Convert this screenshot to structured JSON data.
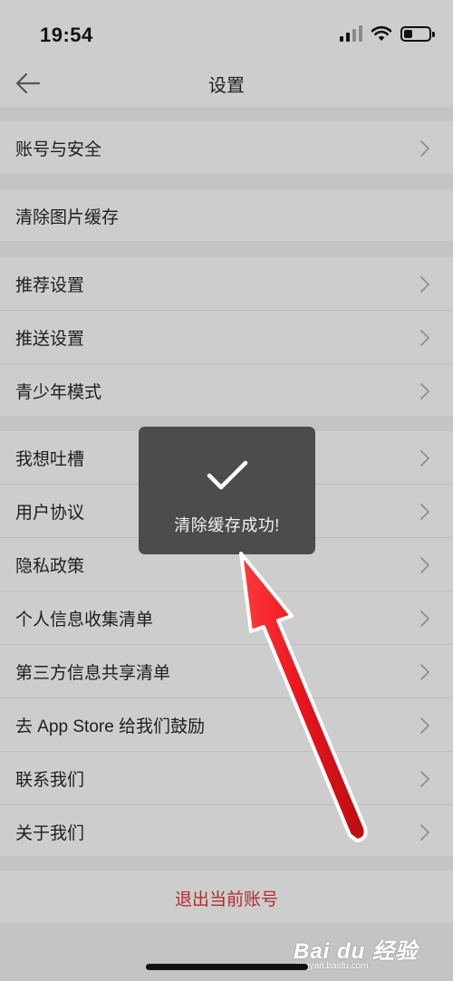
{
  "status_bar": {
    "time": "19:54"
  },
  "nav": {
    "title": "设置"
  },
  "groups": [
    {
      "items": [
        {
          "label": "账号与安全",
          "has_chevron": true
        }
      ]
    },
    {
      "items": [
        {
          "label": "清除图片缓存",
          "has_chevron": false
        }
      ]
    },
    {
      "items": [
        {
          "label": "推荐设置",
          "has_chevron": true
        },
        {
          "label": "推送设置",
          "has_chevron": true
        },
        {
          "label": "青少年模式",
          "has_chevron": true
        }
      ]
    },
    {
      "items": [
        {
          "label": "我想吐槽",
          "has_chevron": true
        },
        {
          "label": "用户协议",
          "has_chevron": true
        },
        {
          "label": "隐私政策",
          "has_chevron": true
        },
        {
          "label": "个人信息收集清单",
          "has_chevron": true
        },
        {
          "label": "第三方信息共享清单",
          "has_chevron": true
        },
        {
          "label": "去 App Store 给我们鼓励",
          "has_chevron": true
        },
        {
          "label": "联系我们",
          "has_chevron": true
        },
        {
          "label": "关于我们",
          "has_chevron": true
        }
      ]
    }
  ],
  "logout": {
    "label": "退出当前账号"
  },
  "toast": {
    "message": "清除缓存成功!"
  },
  "watermark": {
    "logo": "Bai du 经验",
    "url": "jingyan.baidu.com"
  },
  "icons": {
    "back": "arrow-left-icon",
    "chevron": "chevron-right-icon",
    "check": "checkmark-icon",
    "signal": "cellular-signal-icon",
    "wifi": "wifi-icon",
    "battery": "battery-icon"
  },
  "colors": {
    "background": "#c4c4c4",
    "row_background": "#cdcdcd",
    "logout_text": "#b52a2a",
    "toast_background": "#4c4c4c",
    "annotation_arrow": "#e8141c"
  },
  "battery_level": 0.35
}
